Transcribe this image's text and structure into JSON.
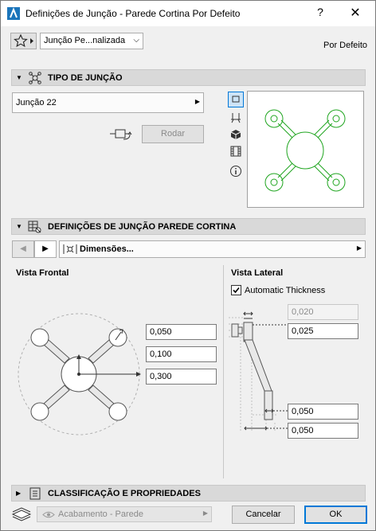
{
  "window": {
    "title": "Definições de Junção - Parede Cortina Por Defeito",
    "help_label": "?",
    "close_label": "✕"
  },
  "favorites": {
    "dropdown_label": "Junção Pe...nalizada",
    "default_label": "Por Defeito"
  },
  "sections": {
    "junction_type": "TIPO DE JUNÇÃO",
    "junction_settings": "DEFINIÇÕES DE JUNÇÃO PAREDE CORTINA",
    "classification": "CLASSIFICAÇÃO E PROPRIEDADES"
  },
  "junction_type": {
    "selected": "Junção 22",
    "rotate_button": "Rodar"
  },
  "panel_nav": {
    "page_label": "Dimensões..."
  },
  "front_view": {
    "title": "Vista Frontal",
    "values": [
      "0,050",
      "0,100",
      "0,300"
    ]
  },
  "side_view": {
    "title": "Vista Lateral",
    "auto_thickness_label": "Automatic Thickness",
    "auto_thickness_checked": true,
    "values": [
      "0,020",
      "0,025",
      "0,050",
      "0,050"
    ]
  },
  "footer": {
    "layer": "Acabamento - Parede",
    "cancel_label": "Cancelar",
    "ok_label": "OK"
  },
  "colors": {
    "preview_green": "#1fa51f",
    "accent_blue": "#0078d7"
  }
}
